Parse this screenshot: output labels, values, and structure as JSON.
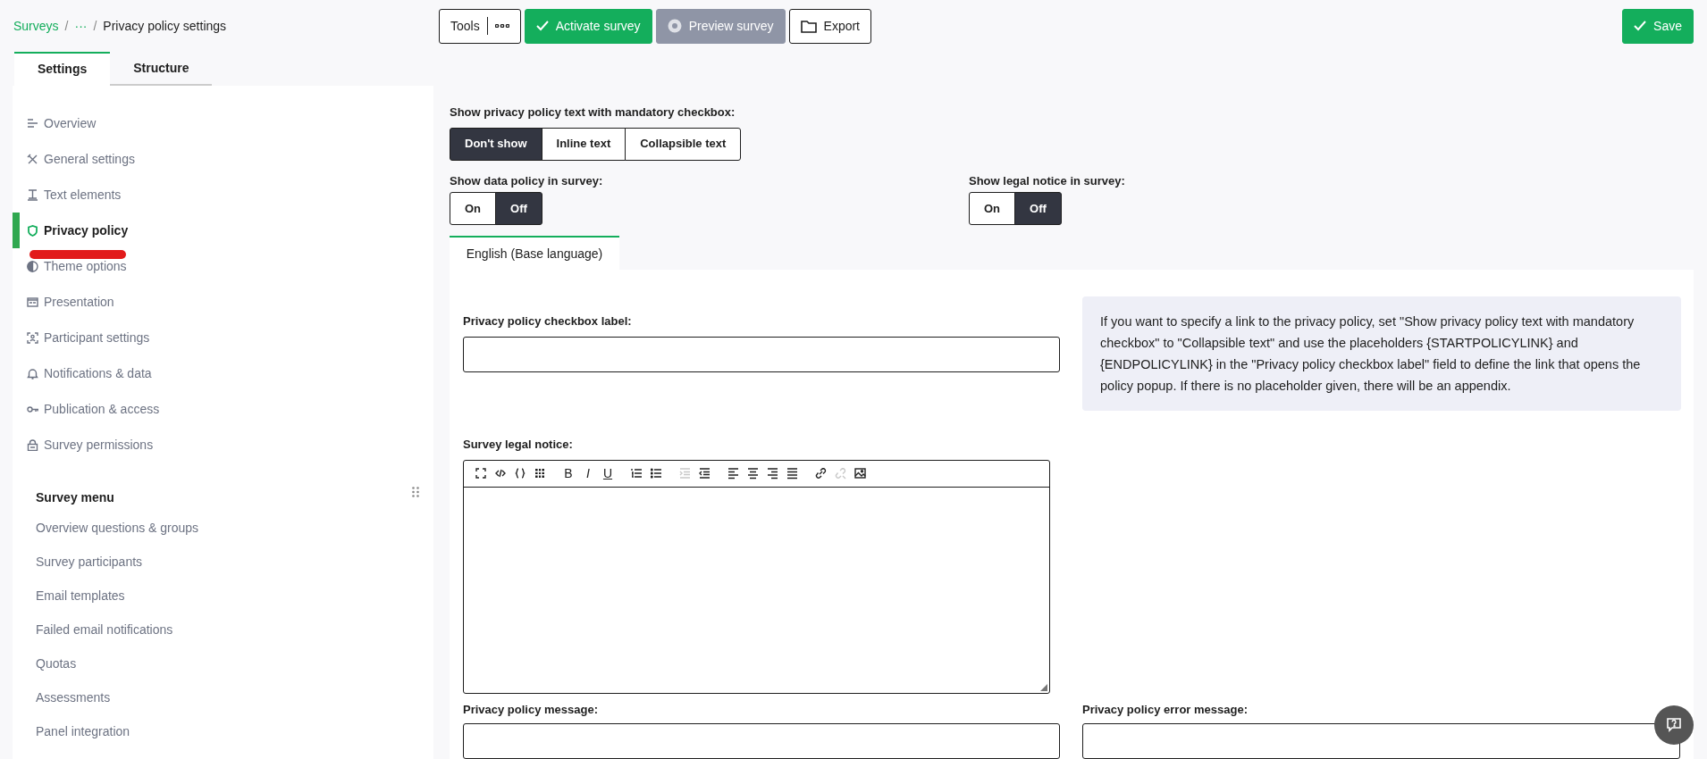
{
  "breadcrumb": [
    {
      "label": "Surveys",
      "kind": "link"
    },
    {
      "label": "/",
      "kind": "separator"
    },
    {
      "label": "···",
      "kind": "link"
    },
    {
      "label": "/",
      "kind": "separator"
    },
    {
      "label": "Privacy policy settings",
      "kind": "current"
    }
  ],
  "toolbar": {
    "tools": {
      "label": "Tools"
    },
    "buttons": [
      {
        "label": "Activate survey",
        "kind": "activate",
        "disabled": false
      },
      {
        "label": "Preview survey",
        "kind": "preview",
        "disabled": true
      },
      {
        "label": "Export",
        "kind": "export",
        "disabled": false
      }
    ],
    "save": {
      "label": "Save"
    }
  },
  "tabs": [
    {
      "label": "Settings",
      "selected": true
    },
    {
      "label": "Structure",
      "selected": false
    }
  ],
  "sidebar": {
    "items": [
      {
        "label": "Overview",
        "selected": false
      },
      {
        "label": "General settings",
        "selected": false
      },
      {
        "label": "Text elements",
        "selected": false
      },
      {
        "label": "Privacy policy",
        "selected": true
      },
      {
        "label": "Theme options",
        "selected": false
      },
      {
        "label": "Presentation",
        "selected": false
      },
      {
        "label": "Participant settings",
        "selected": false
      },
      {
        "label": "Notifications & data",
        "selected": false
      },
      {
        "label": "Publication & access",
        "selected": false
      },
      {
        "label": "Survey permissions",
        "selected": false
      }
    ],
    "survey_menu": {
      "title": "Survey menu",
      "items": [
        "Overview questions & groups",
        "Survey participants",
        "Email templates",
        "Failed email notifications",
        "Quotas",
        "Assessments",
        "Panel integration"
      ]
    }
  },
  "privacy_text_mode": {
    "label": "Show privacy policy text with mandatory checkbox:",
    "options": [
      {
        "label": "Don't show",
        "selected": true
      },
      {
        "label": "Inline text",
        "selected": false
      },
      {
        "label": "Collapsible text",
        "selected": false
      }
    ]
  },
  "data_policy": {
    "label": "Show data policy in survey:",
    "options": [
      {
        "label": "On",
        "selected": false
      },
      {
        "label": "Off",
        "selected": true
      }
    ]
  },
  "legal_notice": {
    "label": "Show legal notice in survey:",
    "options": [
      {
        "label": "On",
        "selected": false
      },
      {
        "label": "Off",
        "selected": true
      }
    ]
  },
  "language_tabs": [
    {
      "label": "English (Base language)",
      "selected": true
    }
  ],
  "checkbox_label_field": {
    "label": "Privacy policy checkbox label:"
  },
  "info": "If you want to specify a link to the privacy policy, set \"Show privacy policy text with mandatory checkbox\" to \"Collapsible text\" and use the placeholders {STARTPOLICYLINK} and {ENDPOLICYLINK} in the \"Privacy policy checkbox label\" field to define the link that opens the policy popup. If there is no placeholder given, there will be an appendix.",
  "legal_notice_editor": {
    "label": "Survey legal notice:",
    "toolbar": [
      {
        "kind": "fullscreen",
        "disabled": false
      },
      {
        "kind": "source",
        "disabled": false
      },
      {
        "kind": "braces",
        "disabled": false
      },
      {
        "kind": "grid",
        "disabled": false
      },
      {
        "kind": "bold",
        "label": "B",
        "disabled": false
      },
      {
        "kind": "italic",
        "label": "I",
        "disabled": false
      },
      {
        "kind": "underline",
        "label": "U",
        "disabled": false
      },
      {
        "kind": "numbered",
        "disabled": false
      },
      {
        "kind": "bulleted",
        "disabled": false
      },
      {
        "kind": "outdent",
        "disabled": true
      },
      {
        "kind": "indent",
        "disabled": false
      },
      {
        "kind": "left",
        "disabled": false
      },
      {
        "kind": "center",
        "disabled": false
      },
      {
        "kind": "right",
        "disabled": false
      },
      {
        "kind": "justify",
        "disabled": false
      },
      {
        "kind": "link",
        "disabled": false
      },
      {
        "kind": "unlink",
        "disabled": true
      },
      {
        "kind": "image",
        "disabled": false
      }
    ]
  },
  "message_fields": [
    {
      "label": "Privacy policy message:"
    },
    {
      "label": "Privacy policy error message:"
    }
  ]
}
